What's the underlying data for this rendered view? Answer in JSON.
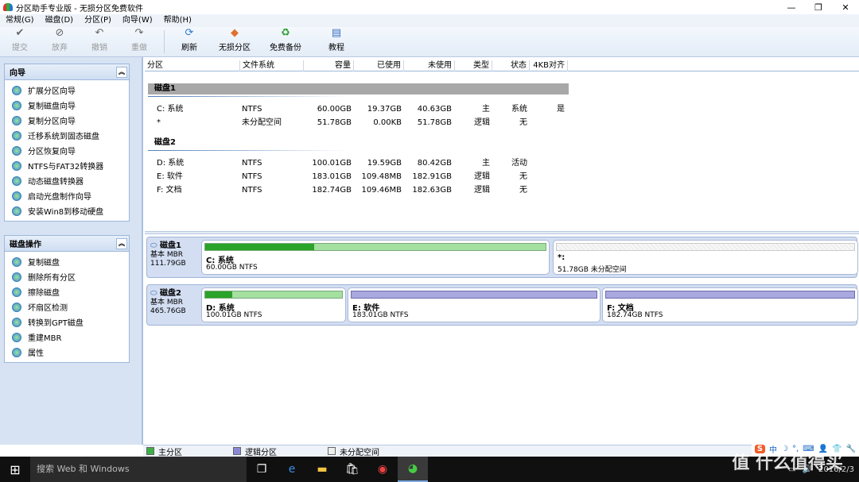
{
  "window": {
    "title": "分区助手专业版 - 无损分区免费软件",
    "controls": {
      "minimize": "—",
      "maximize": "❐",
      "close": "✕"
    }
  },
  "menu": [
    "常规(G)",
    "磁盘(D)",
    "分区(P)",
    "向导(W)",
    "帮助(H)"
  ],
  "toolbar": [
    {
      "label": "提交",
      "icon": "✔",
      "enabled": false
    },
    {
      "label": "放弃",
      "icon": "⊘",
      "enabled": false
    },
    {
      "label": "撤销",
      "icon": "↶",
      "enabled": false
    },
    {
      "label": "重做",
      "icon": "↷",
      "enabled": false
    },
    {
      "label": "刷新",
      "icon": "⟳",
      "enabled": true
    },
    {
      "label": "无损分区",
      "icon": "◆",
      "enabled": true
    },
    {
      "label": "免费备份",
      "icon": "♻",
      "enabled": true
    },
    {
      "label": "教程",
      "icon": "▤",
      "enabled": true
    }
  ],
  "wizard_panel": {
    "title": "向导",
    "collapse": "︽",
    "items": [
      "扩展分区向导",
      "复制磁盘向导",
      "复制分区向导",
      "迁移系统到固态磁盘",
      "分区恢复向导",
      "NTFS与FAT32转换器",
      "动态磁盘转换器",
      "启动光盘制作向导",
      "安装Win8到移动硬盘"
    ]
  },
  "disk_ops_panel": {
    "title": "磁盘操作",
    "collapse": "︽",
    "items": [
      "复制磁盘",
      "删除所有分区",
      "擦除磁盘",
      "坏扇区检测",
      "转换到GPT磁盘",
      "重建MBR",
      "属性"
    ]
  },
  "table": {
    "columns": [
      "分区",
      "文件系统",
      "容量",
      "已使用",
      "未使用",
      "类型",
      "状态",
      "4KB对齐"
    ],
    "groups": [
      {
        "name": "磁盘1",
        "rows": [
          [
            "C: 系统",
            "NTFS",
            "60.00GB",
            "19.37GB",
            "40.63GB",
            "主",
            "系统",
            "是"
          ],
          [
            "*",
            "未分配空间",
            "51.78GB",
            "0.00KB",
            "51.78GB",
            "逻辑",
            "无",
            ""
          ]
        ]
      },
      {
        "name": "磁盘2",
        "rows": [
          [
            "D: 系统",
            "NTFS",
            "100.01GB",
            "19.59GB",
            "80.42GB",
            "主",
            "活动",
            ""
          ],
          [
            "E: 软件",
            "NTFS",
            "183.01GB",
            "109.48MB",
            "182.91GB",
            "逻辑",
            "无",
            ""
          ],
          [
            "F: 文档",
            "NTFS",
            "182.74GB",
            "109.46MB",
            "182.63GB",
            "逻辑",
            "无",
            ""
          ]
        ]
      }
    ]
  },
  "disk_map": [
    {
      "name": "磁盘1",
      "type": "基本 MBR",
      "size": "111.79GB",
      "partitions": [
        {
          "name": "C: 系统",
          "info": "60.00GB NTFS",
          "kind": "primary",
          "used_fraction": 0.32
        },
        {
          "name": "*:",
          "info": "51.78GB 未分配空间",
          "kind": "unallocated",
          "used_fraction": 0
        }
      ]
    },
    {
      "name": "磁盘2",
      "type": "基本 MBR",
      "size": "465.76GB",
      "partitions": [
        {
          "name": "D: 系统",
          "info": "100.01GB NTFS",
          "kind": "primary",
          "used_fraction": 0.2
        },
        {
          "name": "E: 软件",
          "info": "183.01GB NTFS",
          "kind": "logical",
          "used_fraction": 0
        },
        {
          "name": "F: 文档",
          "info": "182.74GB NTFS",
          "kind": "logical",
          "used_fraction": 0
        }
      ]
    }
  ],
  "legend": [
    {
      "label": "主分区",
      "color": "#3cb043"
    },
    {
      "label": "逻辑分区",
      "color": "#8a88d6"
    },
    {
      "label": "未分配空间",
      "color": "#eeeeee"
    }
  ],
  "taskbar": {
    "search_placeholder": "搜索 Web 和 Windows",
    "date": "2016/2/3"
  },
  "ime_bar": [
    "S",
    "中",
    "☽",
    "°,",
    "⌨",
    "👤",
    "👕",
    "🔧"
  ],
  "watermark": "值 什么值得买"
}
